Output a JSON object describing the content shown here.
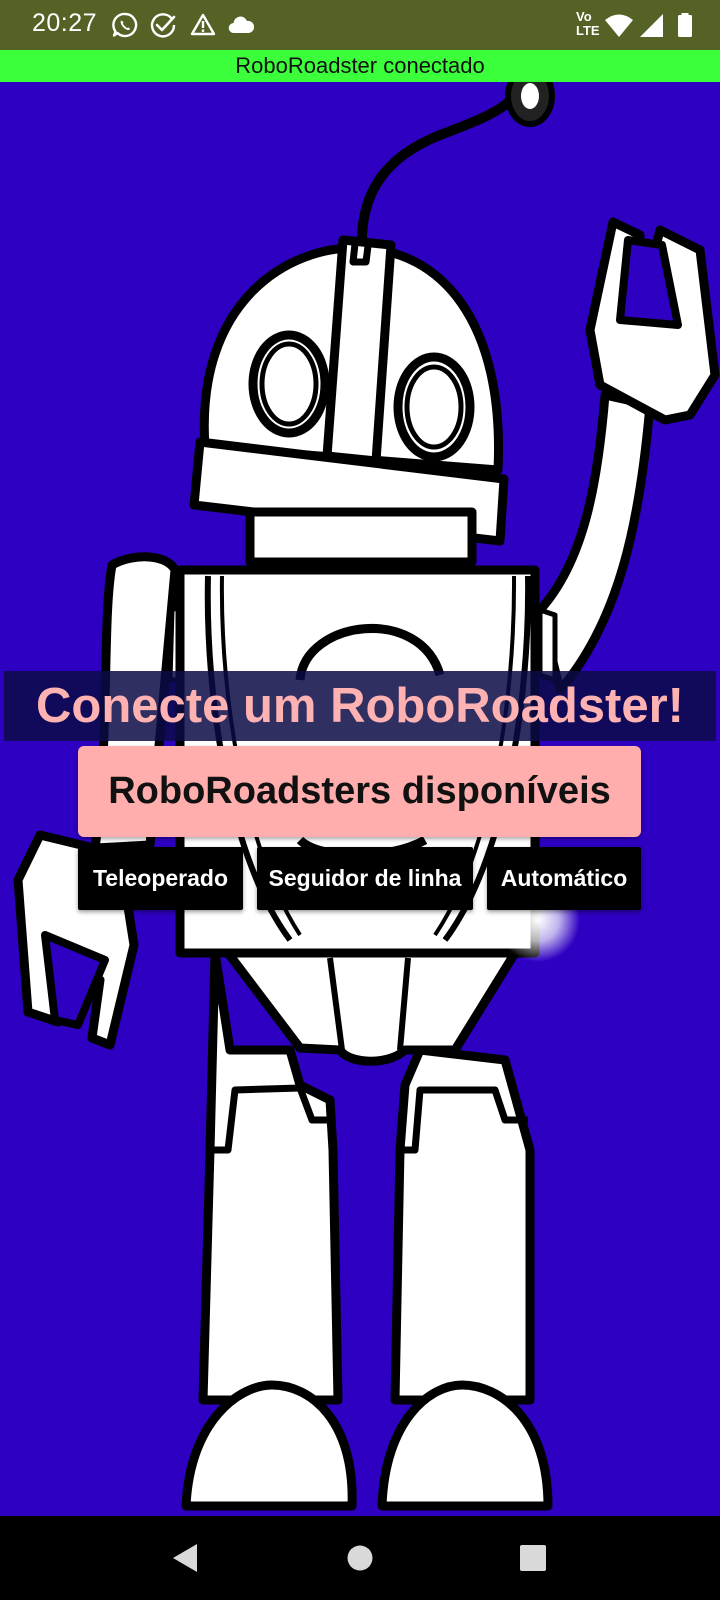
{
  "status_bar": {
    "time": "20:27",
    "left_icons": [
      "whatsapp-icon",
      "check-circle-icon",
      "warning-icon",
      "cloud-icon"
    ],
    "right_icons": [
      "volte-icon",
      "wifi-icon",
      "signal-icon",
      "battery-icon"
    ],
    "volte_text_top": "Vo",
    "volte_text_bottom": "LTE",
    "background_color": "#546325"
  },
  "connection": {
    "status_text": "RoboRoadster conectado",
    "color": "#3cff3c"
  },
  "main": {
    "background_color": "#2e00c2",
    "background_image": "robot-illustration",
    "headline": "Conecte um RoboRoadster!",
    "available_button": "RoboRoadsters disponíveis",
    "modes": [
      {
        "label": "Teleoperado"
      },
      {
        "label": "Seguidor de linha"
      },
      {
        "label": "Automático"
      }
    ]
  },
  "nav_bar": {
    "icons": [
      "back-icon",
      "home-icon",
      "recents-icon"
    ]
  }
}
